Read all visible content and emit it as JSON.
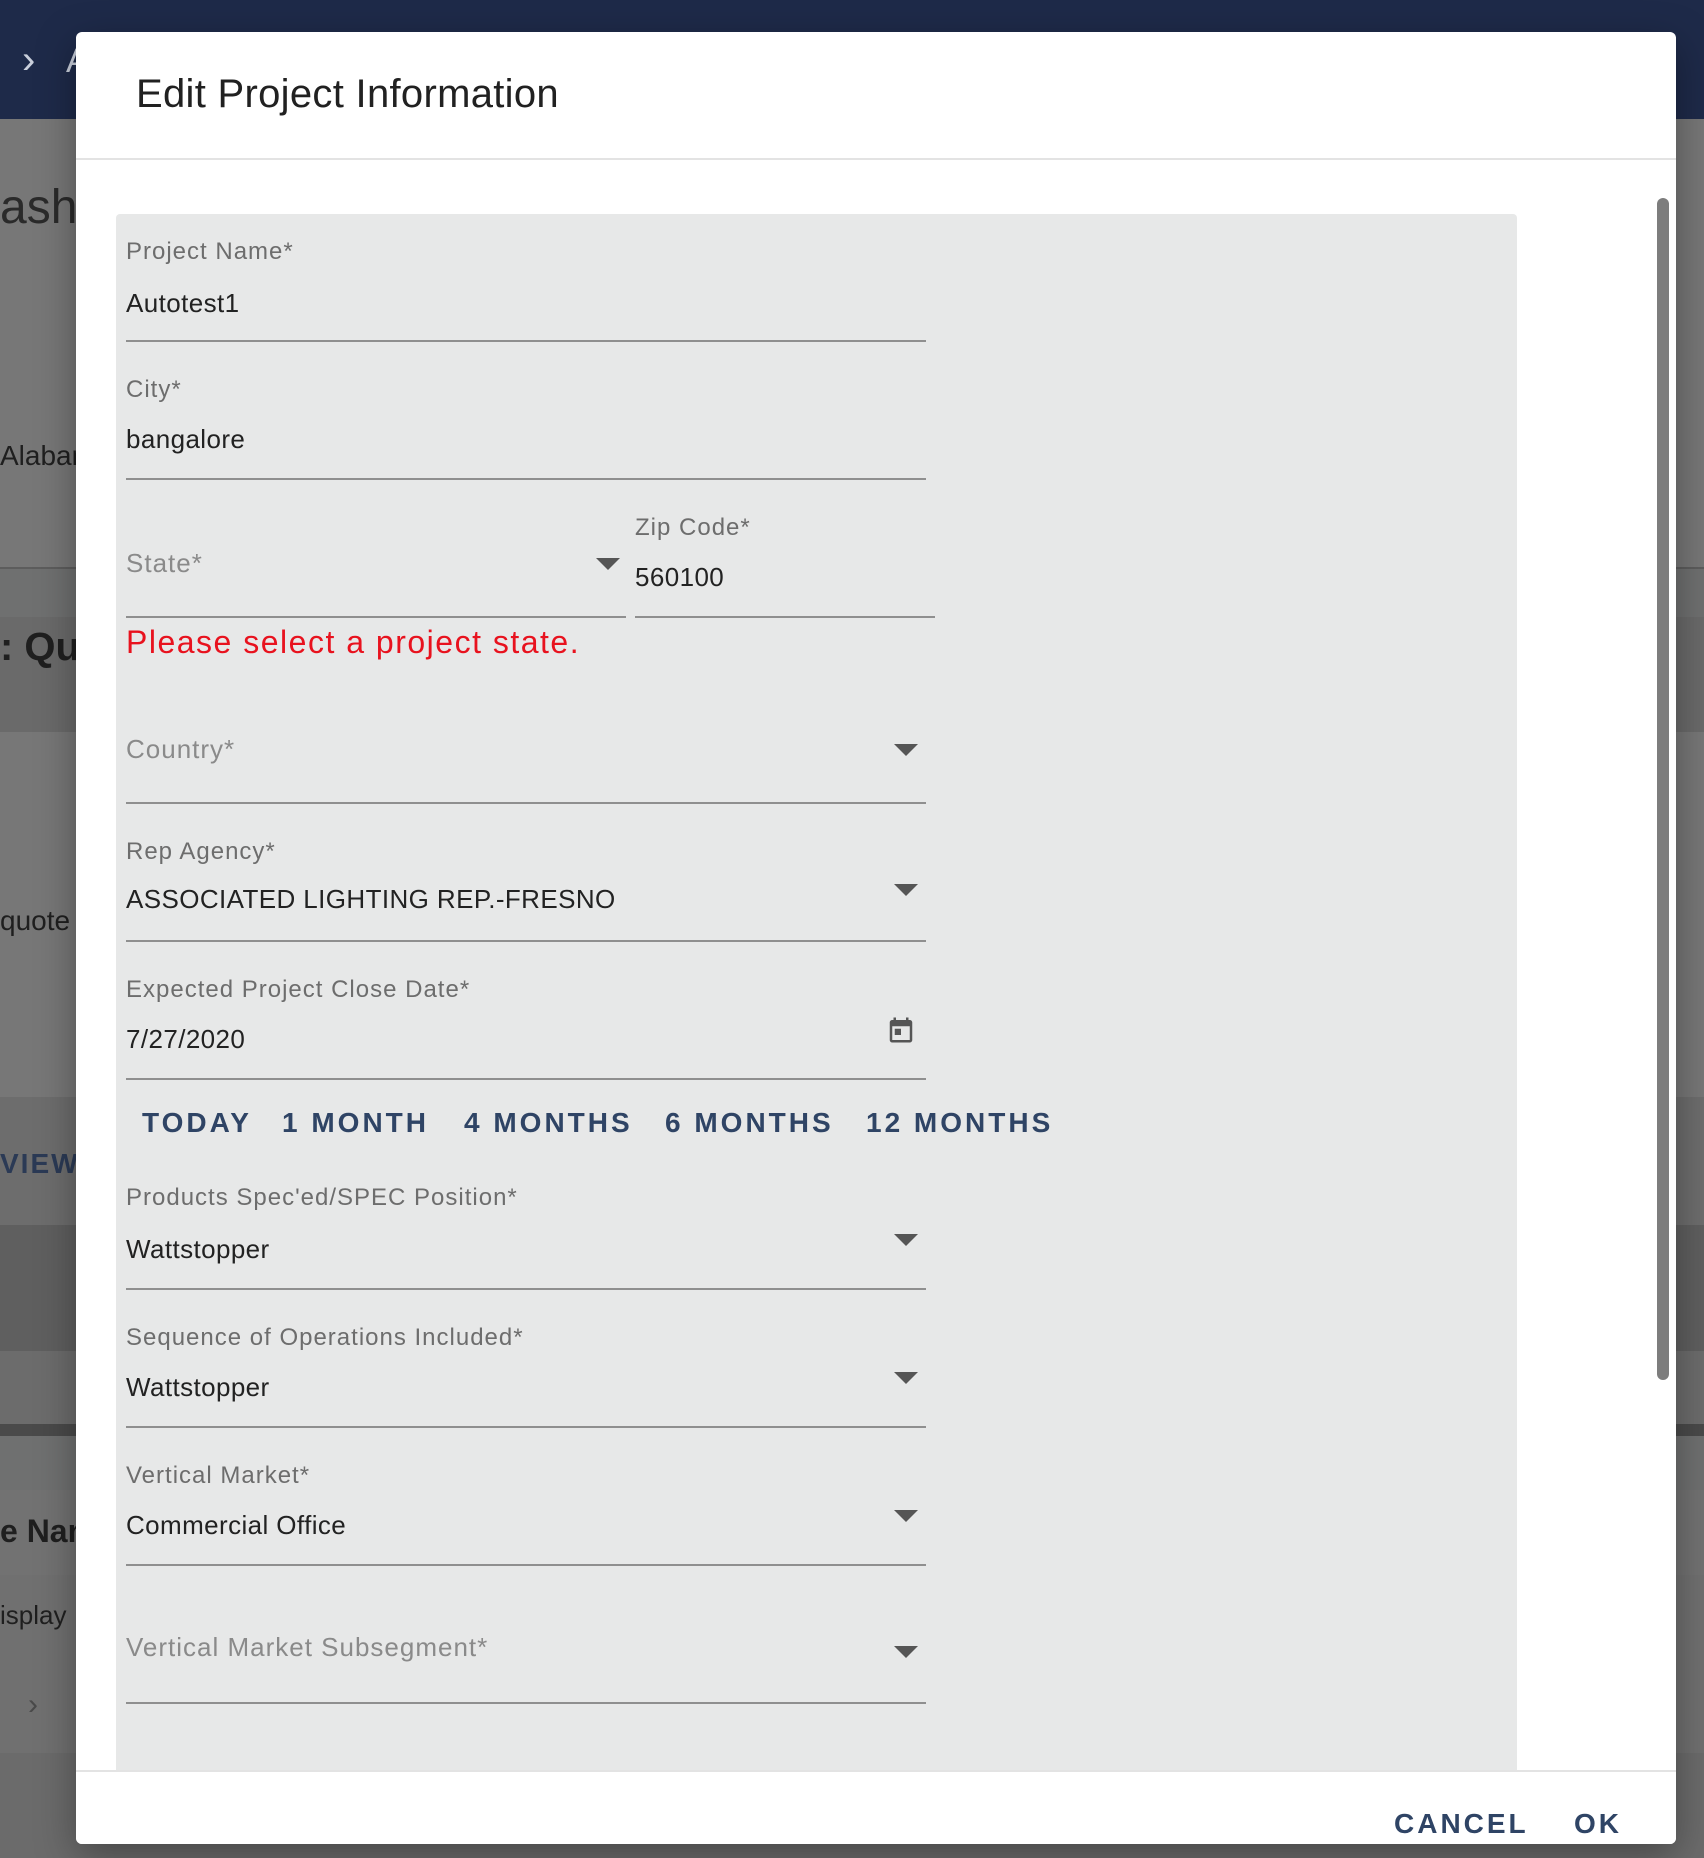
{
  "background": {
    "breadcrumb": "A",
    "dashboard_title": "ashb",
    "state_text": "Alaban",
    "quote_heading": ": Quo",
    "quote_text": "quote r",
    "view_label": "VIEW",
    "name_header": "e Nam",
    "display_text": "isplay"
  },
  "dialog": {
    "title": "Edit Project Information",
    "fields": {
      "project_name": {
        "label": "Project Name*",
        "value": "Autotest1"
      },
      "city": {
        "label": "City*",
        "value": "bangalore"
      },
      "state": {
        "placeholder": "State*"
      },
      "zip_code": {
        "label": "Zip Code*",
        "value": "560100"
      },
      "country": {
        "placeholder": "Country*"
      },
      "rep_agency": {
        "label": "Rep Agency*",
        "value": "ASSOCIATED LIGHTING REP.-FRESNO"
      },
      "close_date": {
        "label": "Expected Project Close Date*",
        "value": "7/27/2020"
      },
      "products_spec": {
        "label": "Products Spec'ed/SPEC Position*",
        "value": "Wattstopper"
      },
      "sequence_ops": {
        "label": "Sequence of Operations Included*",
        "value": "Wattstopper"
      },
      "vertical_market": {
        "label": "Vertical Market*",
        "value": "Commercial Office"
      },
      "vertical_subsegment": {
        "placeholder": "Vertical Market Subsegment*"
      }
    },
    "error": "Please select a project state.",
    "date_shortcuts": [
      "TODAY",
      "1 MONTH",
      "4 MONTHS",
      "6 MONTHS",
      "12 MONTHS"
    ],
    "actions": {
      "cancel": "CANCEL",
      "ok": "OK"
    }
  },
  "colors": {
    "primary_button": "#2f4465",
    "error": "#e8121e",
    "form_background": "#e7e8e8",
    "topbar": "#1e2a49"
  },
  "icons": {
    "dropdown": "chevron-down-icon",
    "calendar": "calendar-icon",
    "breadcrumb": "chevron-right-icon"
  }
}
